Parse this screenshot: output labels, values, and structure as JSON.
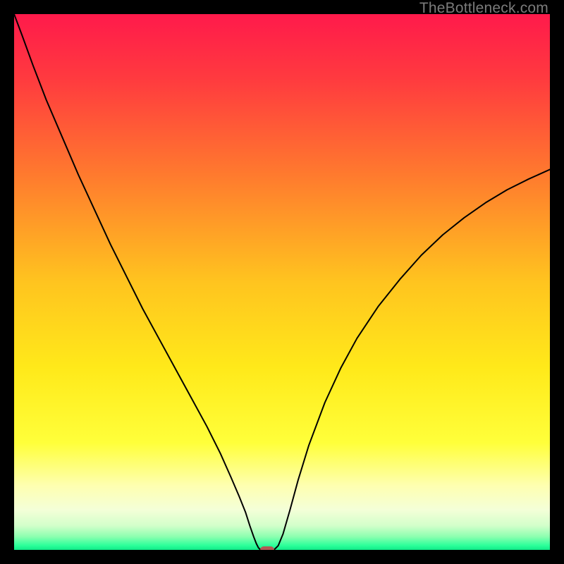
{
  "watermark": {
    "text": "TheBottleneck.com"
  },
  "colors": {
    "frame": "#000000",
    "marker": "#b25a56",
    "curve": "#000000"
  },
  "chart_data": {
    "type": "line",
    "title": "",
    "xlabel": "",
    "ylabel": "",
    "xlim": [
      0,
      100
    ],
    "ylim": [
      0,
      100
    ],
    "gradient_stops": [
      {
        "pos": 0.0,
        "color": "#ff1a4b"
      },
      {
        "pos": 0.12,
        "color": "#ff3a3f"
      },
      {
        "pos": 0.3,
        "color": "#ff7a2e"
      },
      {
        "pos": 0.5,
        "color": "#ffc41f"
      },
      {
        "pos": 0.66,
        "color": "#ffe91a"
      },
      {
        "pos": 0.8,
        "color": "#ffff3a"
      },
      {
        "pos": 0.88,
        "color": "#feffb0"
      },
      {
        "pos": 0.925,
        "color": "#f4ffd8"
      },
      {
        "pos": 0.955,
        "color": "#d2ffca"
      },
      {
        "pos": 0.975,
        "color": "#8dffb0"
      },
      {
        "pos": 0.992,
        "color": "#2bff9a"
      },
      {
        "pos": 1.0,
        "color": "#12e887"
      }
    ],
    "series": [
      {
        "name": "bottleneck-curve",
        "x": [
          0.0,
          1.5,
          3.5,
          6.0,
          9.0,
          12.0,
          15.0,
          18.0,
          21.0,
          24.0,
          27.0,
          30.0,
          33.0,
          36.0,
          38.5,
          40.5,
          42.0,
          43.2,
          44.0,
          44.7,
          45.2,
          45.6,
          46.0,
          47.0,
          48.5,
          49.3,
          50.2,
          51.5,
          53.0,
          55.0,
          58.0,
          61.0,
          64.0,
          68.0,
          72.0,
          76.0,
          80.0,
          84.0,
          88.0,
          92.0,
          96.0,
          100.0
        ],
        "y": [
          100.0,
          96.0,
          90.5,
          84.0,
          77.0,
          70.0,
          63.5,
          57.0,
          51.0,
          45.0,
          39.5,
          34.0,
          28.5,
          23.0,
          18.0,
          13.5,
          10.0,
          7.0,
          4.5,
          2.5,
          1.2,
          0.4,
          0.0,
          0.0,
          0.0,
          0.8,
          3.0,
          7.5,
          13.0,
          19.5,
          27.5,
          34.0,
          39.5,
          45.5,
          50.5,
          55.0,
          58.8,
          62.0,
          64.8,
          67.2,
          69.2,
          71.0
        ]
      }
    ],
    "marker": {
      "x": 47.2,
      "y": 0.0
    }
  }
}
